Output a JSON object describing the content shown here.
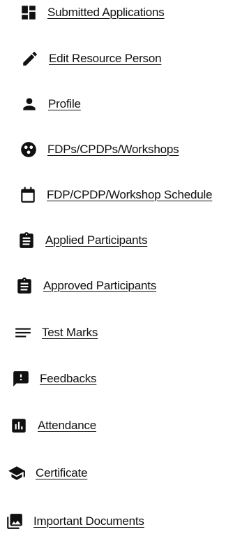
{
  "menu": {
    "items": [
      {
        "label": "Submitted Applications",
        "icon": "dashboard-icon"
      },
      {
        "label": "Edit Resource Person",
        "icon": "pencil-icon"
      },
      {
        "label": "Profile",
        "icon": "person-icon"
      },
      {
        "label": "FDPs/CPDPs/Workshops",
        "icon": "workshop-circle-icon"
      },
      {
        "label": "FDP/CPDP/Workshop Schedule",
        "icon": "calendar-icon"
      },
      {
        "label": "Applied Participants",
        "icon": "clipboard-icon"
      },
      {
        "label": "Approved Participants",
        "icon": "clipboard-icon"
      },
      {
        "label": "Test Marks",
        "icon": "list-lines-icon"
      },
      {
        "label": "Feedbacks",
        "icon": "feedback-icon"
      },
      {
        "label": "Attendance",
        "icon": "bar-chart-icon"
      },
      {
        "label": "Certificate",
        "icon": "graduation-cap-icon"
      },
      {
        "label": "Important Documents",
        "icon": "image-library-icon"
      }
    ]
  },
  "colors": {
    "text": "#111111",
    "icon": "#111111",
    "background": "#ffffff"
  }
}
